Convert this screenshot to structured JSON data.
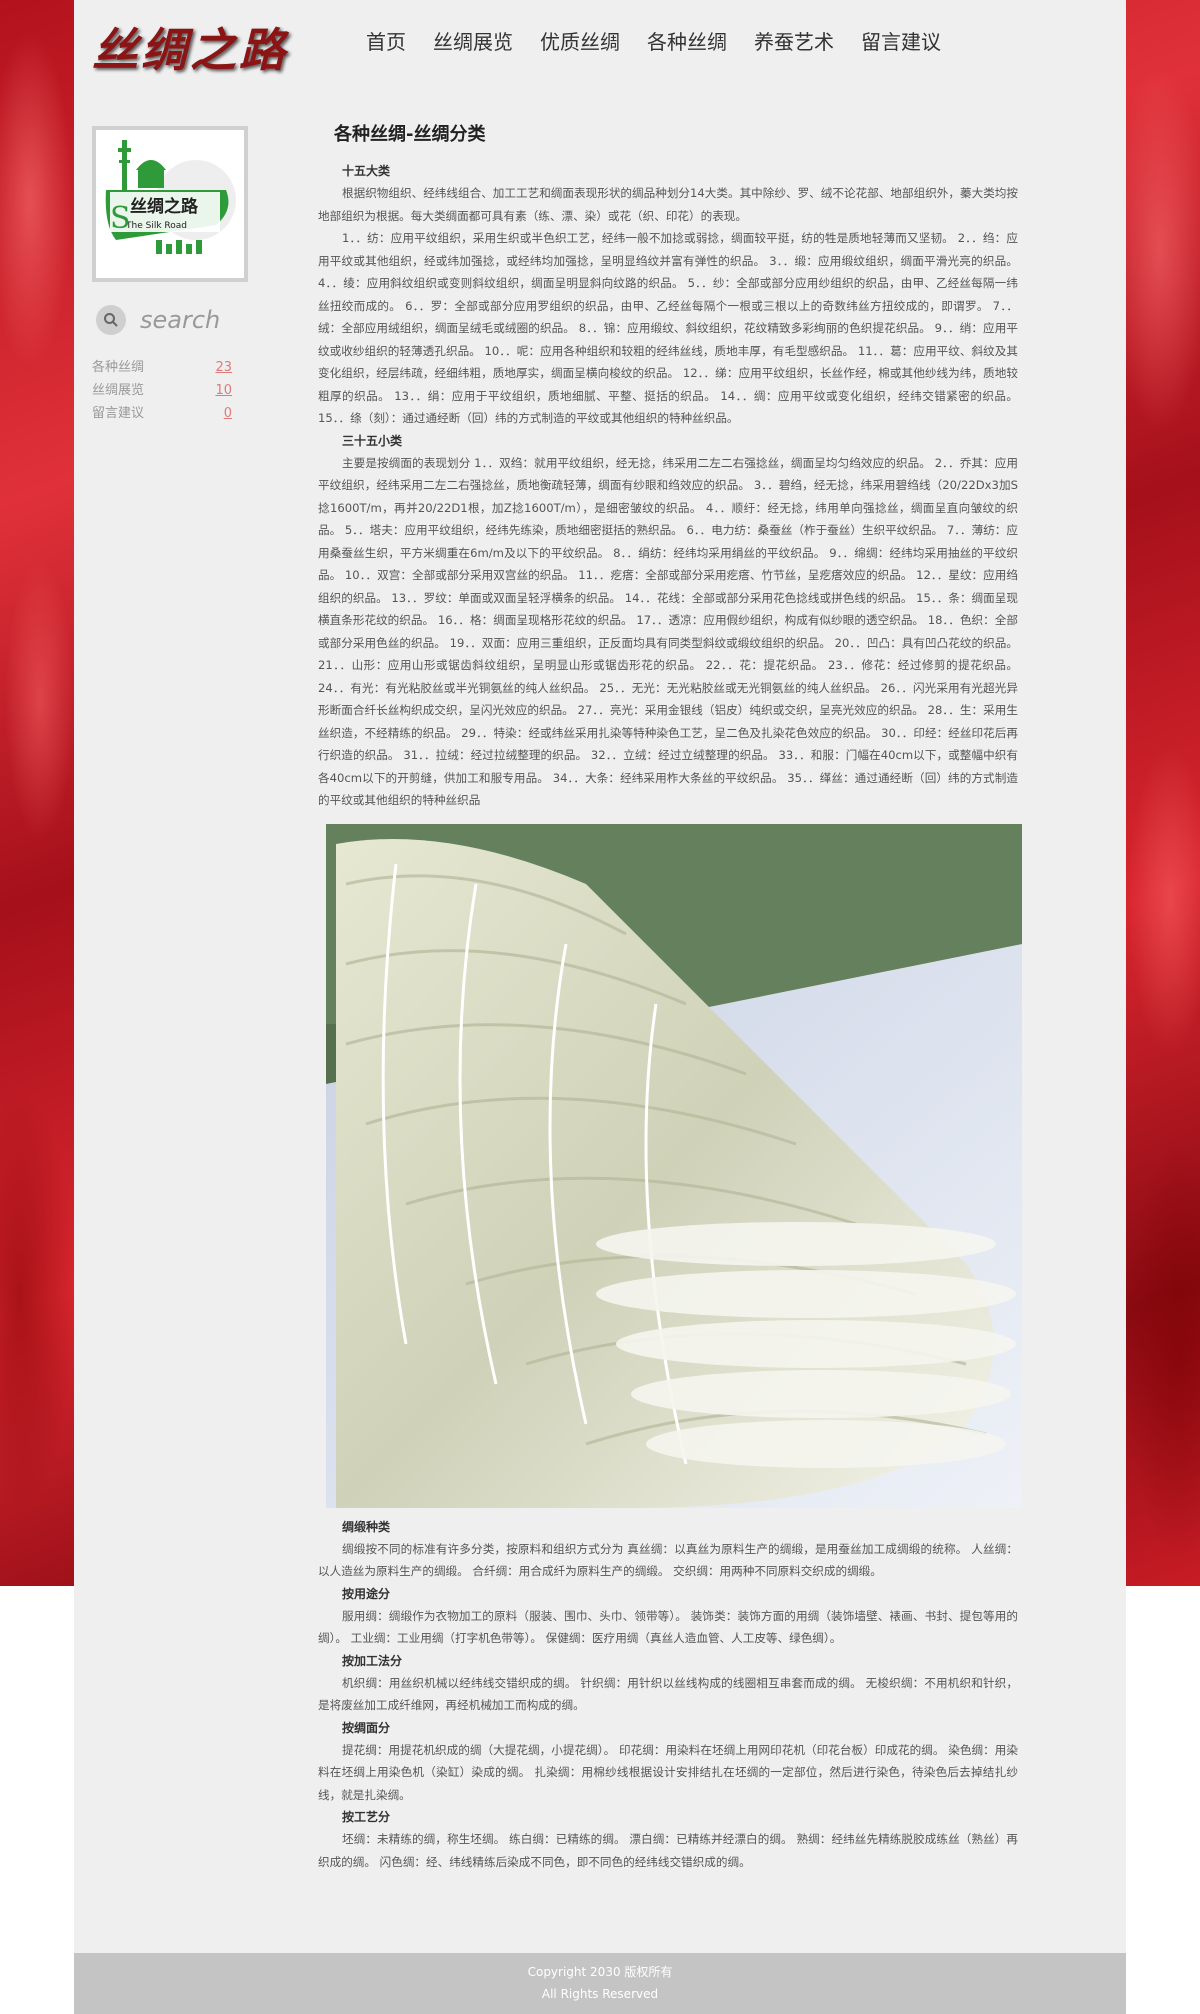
{
  "header": {
    "logo_text": "丝绸之路",
    "nav": [
      "首页",
      "丝绸展览",
      "优质丝绸",
      "各种丝绸",
      "养蚕艺术",
      "留言建议"
    ]
  },
  "sidebar": {
    "logo": {
      "title": "丝绸之路",
      "subtitle": "The Silk Road"
    },
    "search": {
      "placeholder": "search"
    },
    "categories": [
      {
        "name": "各种丝绸",
        "count": "23"
      },
      {
        "name": "丝绸展览",
        "count": "10"
      },
      {
        "name": "留言建议",
        "count": "0"
      }
    ]
  },
  "main": {
    "title": "各种丝绸-丝绸分类",
    "s1_title": "十五大类",
    "s1_intro": "根据织物组织、经纬线组合、加工工艺和绸面表现形状的绸品种划分14大类。其中除纱、罗、绒不论花部、地部组织外，蓁大类均按地部组织为根据。每大类绸面都可具有素（练、漂、染）或花（织、印花）的表现。",
    "s1_body": "1．．纺：应用平纹组织，采用生织或半色织工艺，经纬一般不加捻或弱捻，绸面较平挺，纺的牲是质地轻薄而又坚韧。 2．．绉：应用平纹或其他组织，经或纬加强捻，或经纬均加强捻，呈明显绉纹并富有弹性的织品。 3．．缎：应用缎纹组织，绸面平滑光亮的织品。 4．．绫：应用斜纹组织或变则斜纹组织，绸面呈明显斜向纹路的织品。 5．．纱：全部或部分应用纱组织的织品，由甲、乙经丝每隔一纬丝扭绞而成的。 6．．罗：全部或部分应用罗组织的织品，由甲、乙经丝每隔个一根或三根以上的奇数纬丝方扭绞成的，即谓罗。 7．．绒：全部应用绒组织，绸面呈绒毛或绒圈的织品。 8．．锦：应用缎纹、斜纹组织，花纹精致多彩绚丽的色织提花织品。 9．．绡：应用平纹或收纱组织的轻薄透孔织品。 10．．呢：应用各种组织和较粗的经纬丝线，质地丰厚，有毛型感织品。 11．．葛：应用平纹、斜纹及其变化组织，经层纬疏，经细纬粗，质地厚实，绸面呈横向梭纹的织品。 12．．绨：应用平纹组织，长丝作经，棉或其他纱线为纬，质地较粗厚的织品。 13．．绢：应用于平纹组织，质地细腻、平整、挺括的织品。 14．．绸：应用平纹或变化组织，经纬交错紧密的织品。 15．．绦（刻）：通过通经断（回）纬的方式制造的平纹或其他组织的特种丝织品。",
    "s2_title": "三十五小类",
    "s2_body": "主要是按绸面的表现划分 1．．双绉：就用平纹组织，经无捻，纬采用二左二右强捻丝，绸面呈均匀绉效应的织品。 2．．乔其：应用平纹组织，经纬采用二左二右强捻丝，质地衡疏轻薄，绸面有纱眼和绉效应的织品。 3．．碧绉，经无捻，纬采用碧绉线（20/22Dx3加S捻1600T/m，再并20/22D1根，加Z捻1600T/m），是细密皱纹的织品。 4．．顺纡：经无捻，纬用单向强捻丝，绸面呈直向皱纹的织品。 5．．塔夫：应用平纹组织，经纬先练染，质地细密挺括的熟织品。 6．．电力纺：桑蚕丝（柞于蚕丝）生织平纹织品。 7．．薄纺：应用桑蚕丝生织，平方米绸重在6m/m及以下的平纹织品。 8．．绢纺：经纬均采用绢丝的平纹织品。 9．．绵绸：经纬均采用抽丝的平纹织品。 10．．双宫：全部或部分采用双宫丝的织品。 11．．疙瘩：全部或部分采用疙瘩、竹节丝，呈疙瘩效应的织品。 12．．星纹：应用绉组织的织品。 13．．罗纹：单面或双面呈轻浮横条的织品。 14．．花线：全部或部分采用花色捻线或拼色线的织品。 15．．条：绸面呈现横直条形花纹的织品。 16．．格：绸面呈现格形花纹的织品。 17．．透凉：应用假纱组织，构成有似纱眼的透空织品。 18．．色织：全部或部分采用色丝的织品。 19．．双面：应用三重组织，正反面均具有同类型斜纹或缎纹组织的织品。 20．．凹凸：具有凹凸花纹的织品。 21．．山形：应用山形或锯齿斜纹组织，呈明显山形或锯齿形花的织品。 22．．花：提花织品。 23．．修花：经过修剪的提花织品。 24．．有光：有光粘胶丝或半光铜氨丝的纯人丝织品。 25．．无光：无光粘胶丝或无光铜氨丝的纯人丝织品。 26．．闪光采用有光超光异形断面合纤长丝构织成交织，呈闪光效应的织品。 27．．亮光：采用金银线（铝皮）纯织或交织，呈亮光效应的织品。 28．．生：采用生丝织造，不经精练的织品。 29．．特染：经或纬丝采用扎染等特种染色工艺，呈二色及扎染花色效应的织品。 30．．印经：经丝印花后再行织造的织品。 31．．拉绒：经过拉绒整理的织品。 32．．立绒：经过立绒整理的织品。 33．．和服：门幅在40cm以下，或整幅中织有各40cm以下的开剪缝，供加工和服专用品。 34．．大条：经纬采用柞大条丝的平纹织品。 35．．缂丝：通过通经断（回）纬的方式制造的平纹或其他组织的特种丝织品",
    "s3_title": "绸缎种类",
    "s3_body": "绸缎按不同的标准有许多分类，按原料和组织方式分为 真丝绸：以真丝为原料生产的绸缎，是用蚕丝加工成绸缎的统称。 人丝绸：以人造丝为原料生产的绸缎。 合纤绸：用合成纤为原料生产的绸缎。 交织绸：用两种不同原料交织成的绸缎。",
    "s4_title": "按用途分",
    "s4_body": "服用绸：绸缎作为衣物加工的原料（服装、围巾、头巾、领带等）。 装饰类：装饰方面的用绸（装饰墙壁、裱画、书封、提包等用的绸）。 工业绸：工业用绸（打字机色带等）。 保健绸：医疗用绸（真丝人造血管、人工皮等、绿色绸）。",
    "s5_title": "按加工法分",
    "s5_body": "机织绸：用丝织机械以经纬线交错织成的绸。 针织绸：用针织以丝线构成的线圈相互串套而成的绸。 无梭织绸：不用机织和针织，是将废丝加工成纤维网，再经机械加工而构成的绸。",
    "s6_title": "按绸面分",
    "s6_body": "提花绸：用提花机织成的绸（大提花绸，小提花绸）。 印花绸：用染料在坯绸上用网印花机（印花台板）印成花的绸。 染色绸：用染料在坯绸上用染色机（染缸）染成的绸。 扎染绸：用棉纱线根据设计安排结扎在坯绸的一定部位，然后进行染色，待染色后去掉结扎纱线，就是扎染绸。",
    "s7_title": "按工艺分",
    "s7_body": "坯绸：未精练的绸，称生坯绸。 练白绸：已精练的绸。 漂白绸：已精练并经漂白的绸。 熟绸：经纬丝先精练脱胶成练丝（熟丝）再织成的绸。 闪色绸：经、纬线精练后染成不同色，即不同色的经纬线交错织成的绸。"
  },
  "footer": {
    "line1": "Copyright 2030 版权所有",
    "line2": "All Rights Reserved"
  }
}
